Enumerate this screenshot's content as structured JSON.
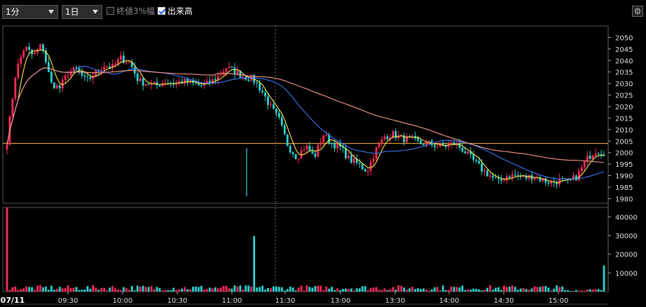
{
  "toolbar": {
    "interval": "1分",
    "period": "1日",
    "option_close3": "終値3%幅",
    "option_volume": "出来高",
    "close3_checked": false,
    "volume_checked": true,
    "settings_icon": "gear-icon"
  },
  "colors": {
    "background": "#000000",
    "up": "#ff2a5a",
    "down": "#2ad4d4",
    "ma_short": "#ffe94a",
    "ma_mid": "#3a78ff",
    "ma_long": "#ff9a8a",
    "ref_line": "#e8a33a",
    "grid": "#3a3a3a"
  },
  "chart_data": [
    {
      "type": "candlestick",
      "name": "price",
      "y_ticks": [
        "2050",
        "2045",
        "2040",
        "2035",
        "2030",
        "2025",
        "2020",
        "2015",
        "2010",
        "2005",
        "2000",
        "1995",
        "1990",
        "1985",
        "1980"
      ],
      "ylim": [
        1978,
        2055
      ],
      "reference_line": 2004,
      "x_ticks": [
        "07/11",
        "09:30",
        "10:00",
        "10:30",
        "11:00",
        "11:30",
        "13:00",
        "13:30",
        "14:00",
        "14:30",
        "15:00"
      ],
      "anchor_values": [
        [
          0,
          2005
        ],
        [
          1,
          2035
        ],
        [
          2,
          2046
        ],
        [
          3,
          2042
        ],
        [
          4,
          2047
        ],
        [
          5,
          2030
        ],
        [
          6,
          2028
        ],
        [
          7,
          2035
        ],
        [
          8,
          2036
        ],
        [
          9,
          2031
        ],
        [
          10,
          2034
        ],
        [
          11,
          2038
        ],
        [
          12,
          2037
        ],
        [
          13,
          2041
        ],
        [
          14,
          2039
        ],
        [
          15,
          2031
        ],
        [
          16,
          2030
        ],
        [
          17,
          2029
        ],
        [
          18,
          2031
        ],
        [
          19,
          2030
        ],
        [
          20,
          2031
        ],
        [
          21,
          2030
        ],
        [
          22,
          2029
        ],
        [
          23,
          2030
        ],
        [
          24,
          2033
        ],
        [
          25,
          2037
        ],
        [
          26,
          2035
        ],
        [
          27,
          2033
        ],
        [
          28,
          2032
        ],
        [
          29,
          2027
        ],
        [
          30,
          2020
        ],
        [
          31,
          2014
        ],
        [
          32,
          2003
        ],
        [
          33,
          1998
        ],
        [
          34,
          2003
        ],
        [
          35,
          1998
        ],
        [
          36,
          2008
        ],
        [
          37,
          2004
        ],
        [
          38,
          2002
        ],
        [
          39,
          1997
        ],
        [
          40,
          1995
        ],
        [
          41,
          1992
        ],
        [
          42,
          2001
        ],
        [
          43,
          2007
        ],
        [
          44,
          2008
        ],
        [
          45,
          2006
        ],
        [
          46,
          2006
        ],
        [
          47,
          2004
        ],
        [
          48,
          2004
        ],
        [
          49,
          2003
        ],
        [
          50,
          2003
        ],
        [
          51,
          2004
        ],
        [
          52,
          2001
        ],
        [
          53,
          1997
        ],
        [
          54,
          1993
        ],
        [
          55,
          1990
        ],
        [
          56,
          1987
        ],
        [
          57,
          1990
        ],
        [
          58,
          1990
        ],
        [
          59,
          1989
        ],
        [
          60,
          1990
        ],
        [
          61,
          1988
        ],
        [
          62,
          1987
        ],
        [
          63,
          1988
        ],
        [
          64,
          1987
        ],
        [
          65,
          1990
        ],
        [
          66,
          1997
        ],
        [
          67,
          2001
        ],
        [
          68,
          2000
        ]
      ]
    },
    {
      "type": "bar",
      "name": "volume",
      "y_ticks": [
        "40000",
        "30000",
        "20000",
        "10000"
      ],
      "ylim": [
        0,
        45000
      ],
      "spikes": [
        [
          0,
          45000
        ],
        [
          89,
          29700
        ],
        [
          215,
          14000
        ]
      ],
      "base_level": 1800
    }
  ]
}
